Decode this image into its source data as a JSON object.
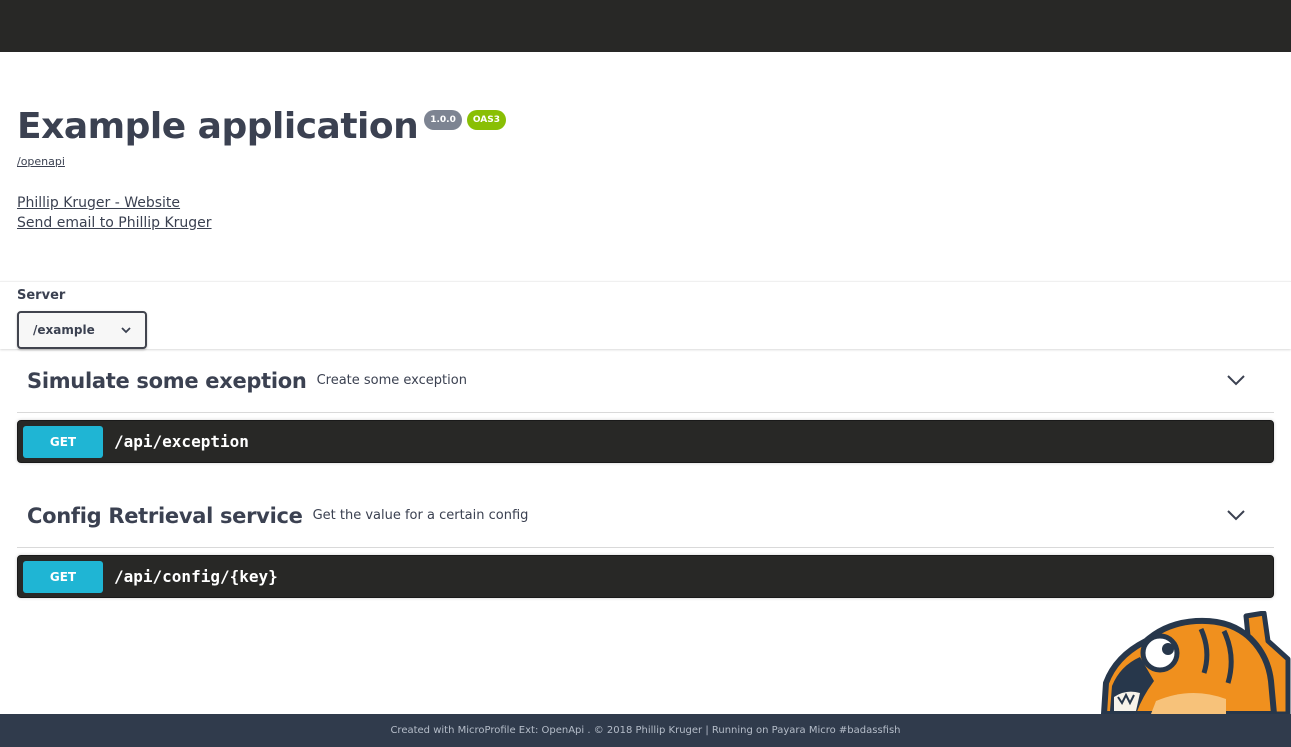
{
  "info": {
    "title": "Example application",
    "version_badge": "1.0.0",
    "oas_badge": "OAS3",
    "spec_link": "/openapi",
    "contact_website": "Phillip Kruger - Website",
    "contact_email": "Send email to Phillip Kruger"
  },
  "servers": {
    "label": "Server",
    "selected": "/example"
  },
  "tags": [
    {
      "name": "Simulate some exeption",
      "description": "Create some exception",
      "operations": [
        {
          "method": "GET",
          "path": "/api/exception"
        }
      ]
    },
    {
      "name": "Config Retrieval service",
      "description": "Get the value for a certain config",
      "operations": [
        {
          "method": "GET",
          "path": "/api/config/{key}"
        }
      ]
    }
  ],
  "footer": {
    "text": "Created with MicroProfile Ext: OpenApi . © 2018 Phillip Kruger | Running on Payara Micro #badassfish"
  },
  "colors": {
    "topbar": "#282826",
    "get_method": "#1fb5d4",
    "opblock_bg": "#282826",
    "footer_bg": "#303b4c",
    "oas_badge": "#89bf04",
    "version_badge": "#7d8492"
  },
  "icons": {
    "server_dropdown": "chevron-down-icon",
    "tag_toggle": "expand-arrow-icon",
    "mascot": "payara-fish-mascot"
  }
}
